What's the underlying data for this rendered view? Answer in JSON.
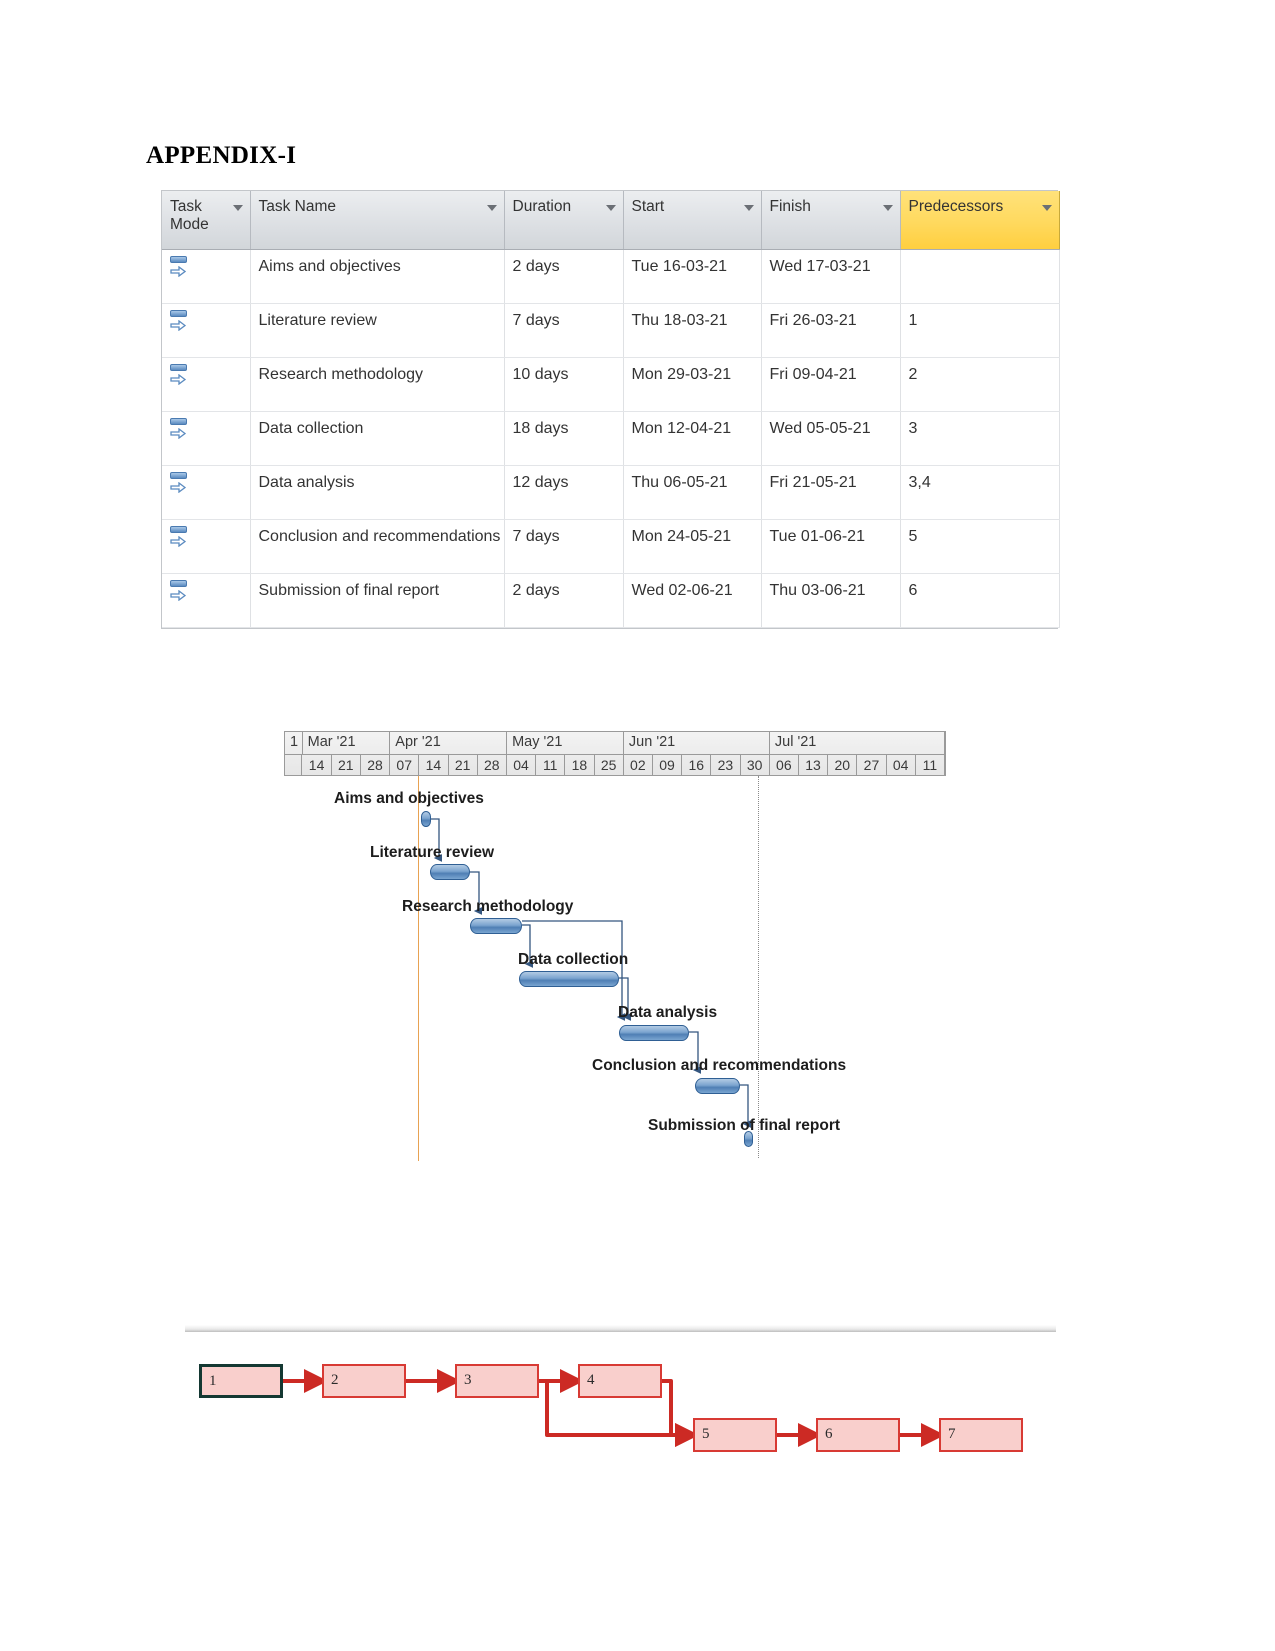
{
  "page": {
    "heading": "APPENDIX-I"
  },
  "task_table": {
    "columns": [
      {
        "key": "mode",
        "label": "Task Mode",
        "has_filter": true,
        "highlight": false
      },
      {
        "key": "name",
        "label": "Task Name",
        "has_filter": true,
        "highlight": false
      },
      {
        "key": "duration",
        "label": "Duration",
        "has_filter": true,
        "highlight": false
      },
      {
        "key": "start",
        "label": "Start",
        "has_filter": true,
        "highlight": false
      },
      {
        "key": "finish",
        "label": "Finish",
        "has_filter": true,
        "highlight": false
      },
      {
        "key": "pred",
        "label": "Predecessors",
        "has_filter": true,
        "highlight": true
      }
    ],
    "mode_icon": "manually-scheduled-icon",
    "rows": [
      {
        "id": 1,
        "name": "Aims and objectives",
        "duration": "2 days",
        "start": "Tue 16-03-21",
        "finish": "Wed 17-03-21",
        "pred": ""
      },
      {
        "id": 2,
        "name": "Literature review",
        "duration": "7 days",
        "start": "Thu 18-03-21",
        "finish": "Fri 26-03-21",
        "pred": "1"
      },
      {
        "id": 3,
        "name": "Research methodology",
        "duration": "10 days",
        "start": "Mon 29-03-21",
        "finish": "Fri 09-04-21",
        "pred": "2"
      },
      {
        "id": 4,
        "name": "Data collection",
        "duration": "18 days",
        "start": "Mon 12-04-21",
        "finish": "Wed 05-05-21",
        "pred": "3"
      },
      {
        "id": 5,
        "name": "Data analysis",
        "duration": "12 days",
        "start": "Thu 06-05-21",
        "finish": "Fri 21-05-21",
        "pred": "3,4"
      },
      {
        "id": 6,
        "name": "Conclusion and recommendations",
        "duration": "7 days",
        "start": "Mon 24-05-21",
        "finish": "Tue 01-06-21",
        "pred": "5"
      },
      {
        "id": 7,
        "name": "Submission of final report",
        "duration": "2 days",
        "start": "Wed 02-06-21",
        "finish": "Thu 03-06-21",
        "pred": "6"
      }
    ]
  },
  "chart_data": {
    "type": "bar",
    "title": "Project schedule Gantt chart",
    "xlabel": "",
    "ylabel": "",
    "timeline": {
      "leading_partial_label": "1",
      "months": [
        "Mar '21",
        "Apr '21",
        "May '21",
        "Jun '21",
        "Jul '21"
      ],
      "weeks": [
        "14",
        "21",
        "28",
        "07",
        "14",
        "21",
        "28",
        "04",
        "11",
        "18",
        "25",
        "02",
        "09",
        "16",
        "23",
        "30",
        "06",
        "13",
        "20",
        "27",
        "04",
        "11"
      ],
      "today_marker_week": "14",
      "deadline_marker_week": "30"
    },
    "tasks": [
      {
        "id": 1,
        "label": "Aims and objectives",
        "start": "Tue 16-03-21",
        "finish": "Wed 17-03-21",
        "duration_days": 2,
        "predecessors": ""
      },
      {
        "id": 2,
        "label": "Literature review",
        "start": "Thu 18-03-21",
        "finish": "Fri 26-03-21",
        "duration_days": 7,
        "predecessors": "1"
      },
      {
        "id": 3,
        "label": "Research methodology",
        "start": "Mon 29-03-21",
        "finish": "Fri 09-04-21",
        "duration_days": 10,
        "predecessors": "2"
      },
      {
        "id": 4,
        "label": "Data collection",
        "start": "Mon 12-04-21",
        "finish": "Wed 05-05-21",
        "duration_days": 18,
        "predecessors": "3"
      },
      {
        "id": 5,
        "label": "Data analysis",
        "start": "Thu 06-05-21",
        "finish": "Fri 21-05-21",
        "duration_days": 12,
        "predecessors": "3,4"
      },
      {
        "id": 6,
        "label": "Conclusion and recommendations",
        "start": "Mon 24-05-21",
        "finish": "Tue 01-06-21",
        "duration_days": 7,
        "predecessors": "5"
      },
      {
        "id": 7,
        "label": "Submission of final report",
        "start": "Wed 02-06-21",
        "finish": "Thu 03-06-21",
        "duration_days": 2,
        "predecessors": "6"
      }
    ],
    "bar_color": "#4f7fb4",
    "link_color": "#34567f",
    "today_line_color": "#e8a252",
    "deadline_line_color": "#8a8a8a"
  },
  "network_diagram": {
    "node_fill": "#f9cfcc",
    "node_border": "#d83a34",
    "critical_border": "#143832",
    "link_color": "#cc2a24",
    "nodes": [
      {
        "id": "1",
        "label": "1",
        "critical_start": true
      },
      {
        "id": "2",
        "label": "2",
        "critical_start": false
      },
      {
        "id": "3",
        "label": "3",
        "critical_start": false
      },
      {
        "id": "4",
        "label": "4",
        "critical_start": false
      },
      {
        "id": "5",
        "label": "5",
        "critical_start": false
      },
      {
        "id": "6",
        "label": "6",
        "critical_start": false
      },
      {
        "id": "7",
        "label": "7",
        "critical_start": false
      }
    ],
    "edges": [
      {
        "from": "1",
        "to": "2"
      },
      {
        "from": "2",
        "to": "3"
      },
      {
        "from": "3",
        "to": "4"
      },
      {
        "from": "3",
        "to": "5"
      },
      {
        "from": "4",
        "to": "5"
      },
      {
        "from": "5",
        "to": "6"
      },
      {
        "from": "6",
        "to": "7"
      }
    ]
  }
}
